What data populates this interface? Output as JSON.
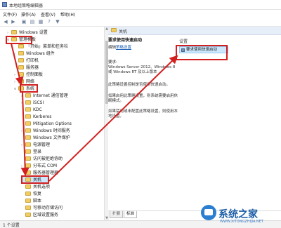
{
  "window": {
    "title": "本地组策略编辑器"
  },
  "menu": [
    "文件(F)",
    "操作(A)",
    "查看(V)",
    "帮助(H)"
  ],
  "toolbar": {
    "icons": [
      "back-icon",
      "forward-icon",
      "up-folder-icon",
      "show-tree-icon",
      "properties-icon",
      "help-icon",
      "filter-icon"
    ]
  },
  "tree": {
    "windows_settings": "Windows 设置",
    "admin_templates": "管理模板",
    "items_l1": [
      "「开始」菜单和任务栏",
      "Windows 组件",
      "打印机",
      "服务器",
      "控制面板",
      "网络"
    ],
    "system": "系统",
    "system_children": [
      "Internet 通信管理",
      "iSCSI",
      "KDC",
      "Kerberos",
      "Mitigation Options",
      "Windows 时间服务",
      "Windows 文件保护",
      "电源管理",
      "登录",
      "访问被拒绝协助",
      "分布式 COM",
      "服务器管理器",
      "关机",
      "关机选项",
      "恢复",
      "脚本",
      "可移动存储访问",
      "区域设置服务"
    ]
  },
  "right": {
    "header": "关机",
    "desc": {
      "title": "要求使用快速启动",
      "edit_prefix": "编辑",
      "edit_link": "策略设置",
      "req_label": "要求:",
      "req_text": "Windows Server 2012、Windows 8 或 Windows RT 及以上版本",
      "p1": "此策略设置控制是否使用快速启动。",
      "p2": "如果启用此策略设置，则系统需要启用休眠模式。",
      "p3": "如果禁用或未配置此策略设置，则使用本地设置。"
    },
    "settings_header": "设置",
    "setting_row": "要求使用快速启动"
  },
  "tabs": [
    "扩展",
    "标准"
  ],
  "status": "1 个设置",
  "watermark": {
    "brand": "系统之家",
    "url": "WWW.XITONGZHIJIA.NET"
  },
  "colors": {
    "annotation": "#d21f1f",
    "selection": "#cce8ff",
    "folder": "#f2cd64"
  }
}
